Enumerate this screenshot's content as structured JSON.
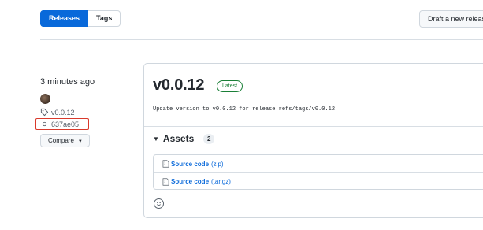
{
  "tabs": [
    {
      "label": "Releases",
      "selected": true
    },
    {
      "label": "Tags",
      "selected": false
    }
  ],
  "draft_button": {
    "label": "Draft a new release"
  },
  "meta": {
    "time": "3 minutes ago",
    "tag": "v0.0.12",
    "commit": "637ae05",
    "compare_label": "Compare"
  },
  "release": {
    "title": "v0.0.12",
    "badge": "Latest",
    "body": "Update version to v0.0.12 for release refs/tags/v0.0.12",
    "assets_label": "Assets",
    "assets_count": "2",
    "assets": [
      {
        "name": "Source code",
        "ext": "(zip)"
      },
      {
        "name": "Source code",
        "ext": "(tar.gz)"
      }
    ]
  },
  "colors": {
    "accent": "#0969da",
    "highlight": "#d9392b",
    "latest": "#1a7f37"
  }
}
